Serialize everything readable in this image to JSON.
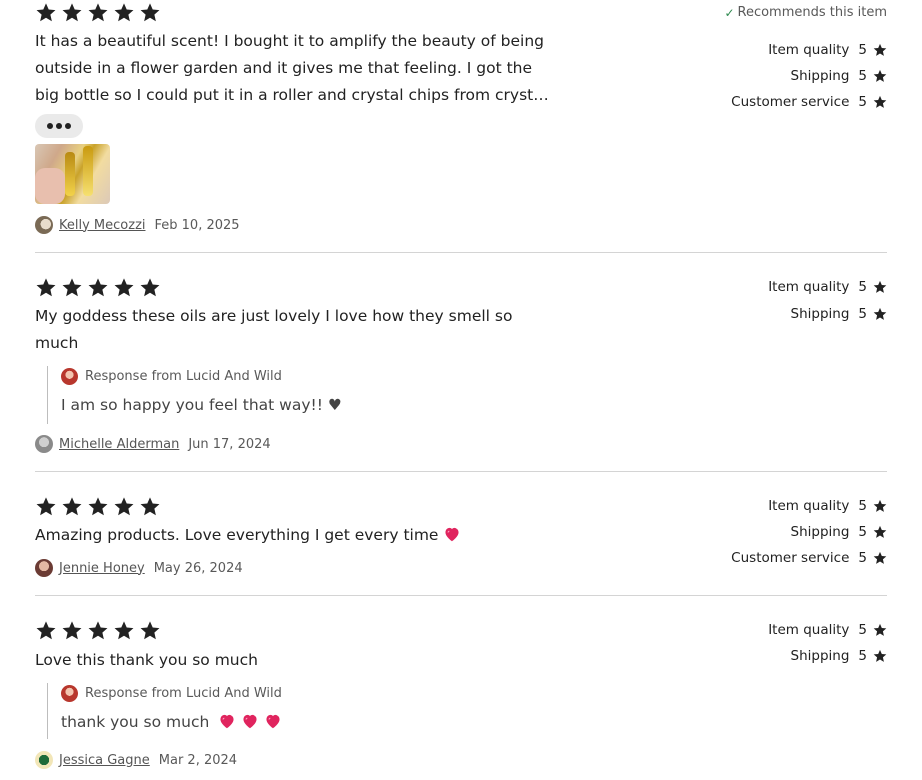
{
  "reviews": [
    {
      "stars": 5,
      "text": "It has a beautiful scent! I bought it to amplify the beauty of being outside in a flower garden and it gives me that feeling. I got the big bottle so I could put it in a roller and crystal chips from cryst…",
      "line1": "It has a beautiful scent! I bought it to amplify the beauty of being",
      "line2": "outside in a flower garden and it gives me that feeling. I got the",
      "line3": "big bottle so I could put it in a roller and crystal chips from cryst…",
      "recommends": "Recommends this item",
      "reviewer": "Kelly Mecozzi",
      "date": "Feb 10, 2025",
      "ratings": [
        {
          "label": "Item quality",
          "value": "5"
        },
        {
          "label": "Shipping",
          "value": "5"
        },
        {
          "label": "Customer service",
          "value": "5"
        }
      ]
    },
    {
      "stars": 5,
      "line1": "My goddess these oils are just lovely I love how they smell so",
      "line2": "much",
      "response_label": "Response from Lucid And Wild",
      "response_text": "I am so happy you feel that way!! ♥",
      "reviewer": "Michelle Alderman",
      "date": "Jun 17, 2024",
      "ratings": [
        {
          "label": "Item quality",
          "value": "5"
        },
        {
          "label": "Shipping",
          "value": "5"
        }
      ]
    },
    {
      "stars": 5,
      "line1": "Amazing products. Love everything I get every time",
      "reviewer": "Jennie Honey",
      "date": "May 26, 2024",
      "ratings": [
        {
          "label": "Item quality",
          "value": "5"
        },
        {
          "label": "Shipping",
          "value": "5"
        },
        {
          "label": "Customer service",
          "value": "5"
        }
      ]
    },
    {
      "stars": 5,
      "line1": "Love this thank you so much",
      "response_label": "Response from Lucid And Wild",
      "response_text": "thank you so much",
      "reviewer": "Jessica Gagne",
      "date": "Mar 2, 2024",
      "ratings": [
        {
          "label": "Item quality",
          "value": "5"
        },
        {
          "label": "Shipping",
          "value": "5"
        }
      ]
    }
  ],
  "icons": {
    "star": "star-icon",
    "check": "check-icon",
    "heart": "sparkling-heart-icon",
    "more": "more-dots-icon"
  },
  "colors": {
    "star": "#222222",
    "check": "#2f8a4f",
    "heart": "#e0245e",
    "divider": "#d4d4d4"
  }
}
